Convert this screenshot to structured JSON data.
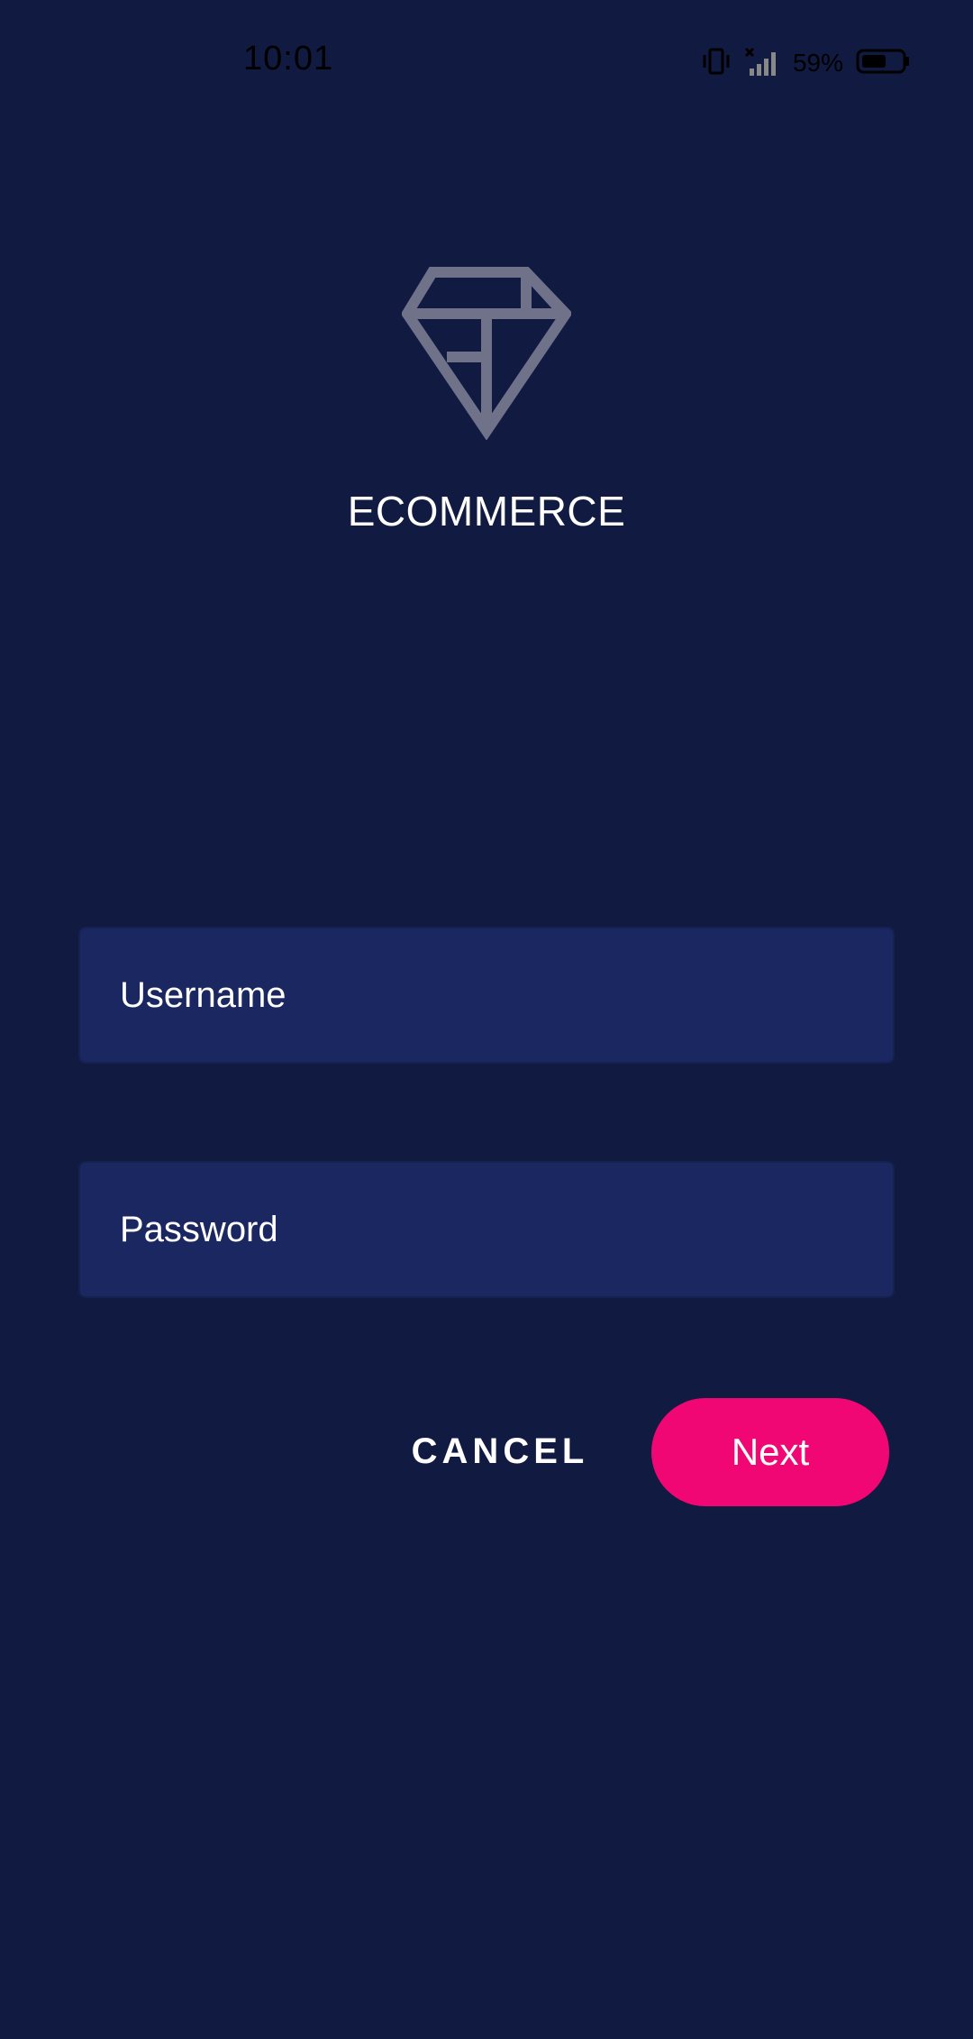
{
  "status_bar": {
    "time": "10:01",
    "battery_percent": "59%",
    "icons": [
      "vibrate-icon",
      "signal-no-service-icon",
      "battery-icon"
    ]
  },
  "app": {
    "logo_icon": "diamond-icon",
    "title": "ECOMMERCE"
  },
  "form": {
    "username_placeholder": "Username",
    "password_placeholder": "Password",
    "username_value": "",
    "password_value": ""
  },
  "actions": {
    "cancel_label": "CANCEL",
    "next_label": "Next"
  },
  "colors": {
    "background": "#111a40",
    "field_background": "#1a2760",
    "accent": "#f10773",
    "logo": "#6f7289"
  }
}
